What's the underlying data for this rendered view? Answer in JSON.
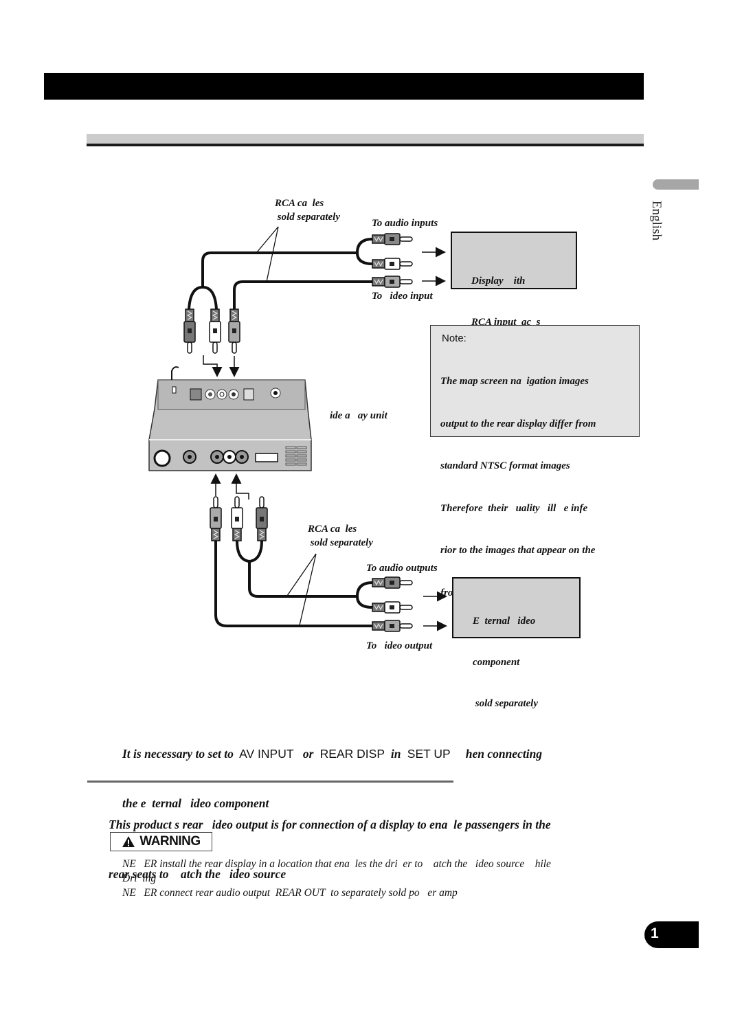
{
  "header": {
    "title": "",
    "subtitle": ""
  },
  "sidebar": {
    "language": "English"
  },
  "diagram_top": {
    "cables_label_line1": "RCA ca  les",
    "cables_label_line2": " sold separately",
    "to_audio_inputs": "To audio inputs",
    "to_video_input": "To   ideo input",
    "display_box_line1": "Display    ith",
    "display_box_line2": "RCA input  ac  s"
  },
  "unit_label": "ide a   ay unit",
  "note": {
    "title": "Note:",
    "lines": [
      "The map screen na  igation images",
      "output to the rear display differ from",
      "standard NTSC format images",
      "Therefore  their   uality   ill   e infe",
      "rior to the images that appear on the",
      "front display"
    ]
  },
  "diagram_bottom": {
    "cables_label_line1": "RCA ca  les",
    "cables_label_line2": " sold separately",
    "to_audio_outputs": "To audio outputs",
    "to_video_output": "To   ideo output",
    "external_box_line1": "E  ternal   ideo",
    "external_box_line2": "component",
    "external_box_line3": " sold separately"
  },
  "instruction": {
    "part1": "It is necessary to set to ",
    "av_input": " AV INPUT ",
    "part2": "  or ",
    "rear_disp": " REAR DISP ",
    "part3": " in ",
    "set_up": " SET UP ",
    "part4": "    hen connecting",
    "line2": "the e  ternal   ideo component"
  },
  "rear_output": {
    "line1": "This product s rear   ideo output is for connection of a display to ena  le passengers in the",
    "line2": "rear seats to    atch the   ideo source"
  },
  "warning": {
    "label": "WARNING",
    "items": [
      "NE   ER install the rear display in a location that ena  les the dri  er to    atch the   ideo source    hile",
      "Dri  ing",
      "NE   ER connect rear audio output  REAR OUT  to separately sold po   er amp"
    ]
  },
  "page": {
    "number": "1"
  },
  "colors": {
    "header": "#000000",
    "subheader": "#cccccc",
    "box_fill": "#d0d0d0",
    "note_fill": "#e4e4e4"
  }
}
